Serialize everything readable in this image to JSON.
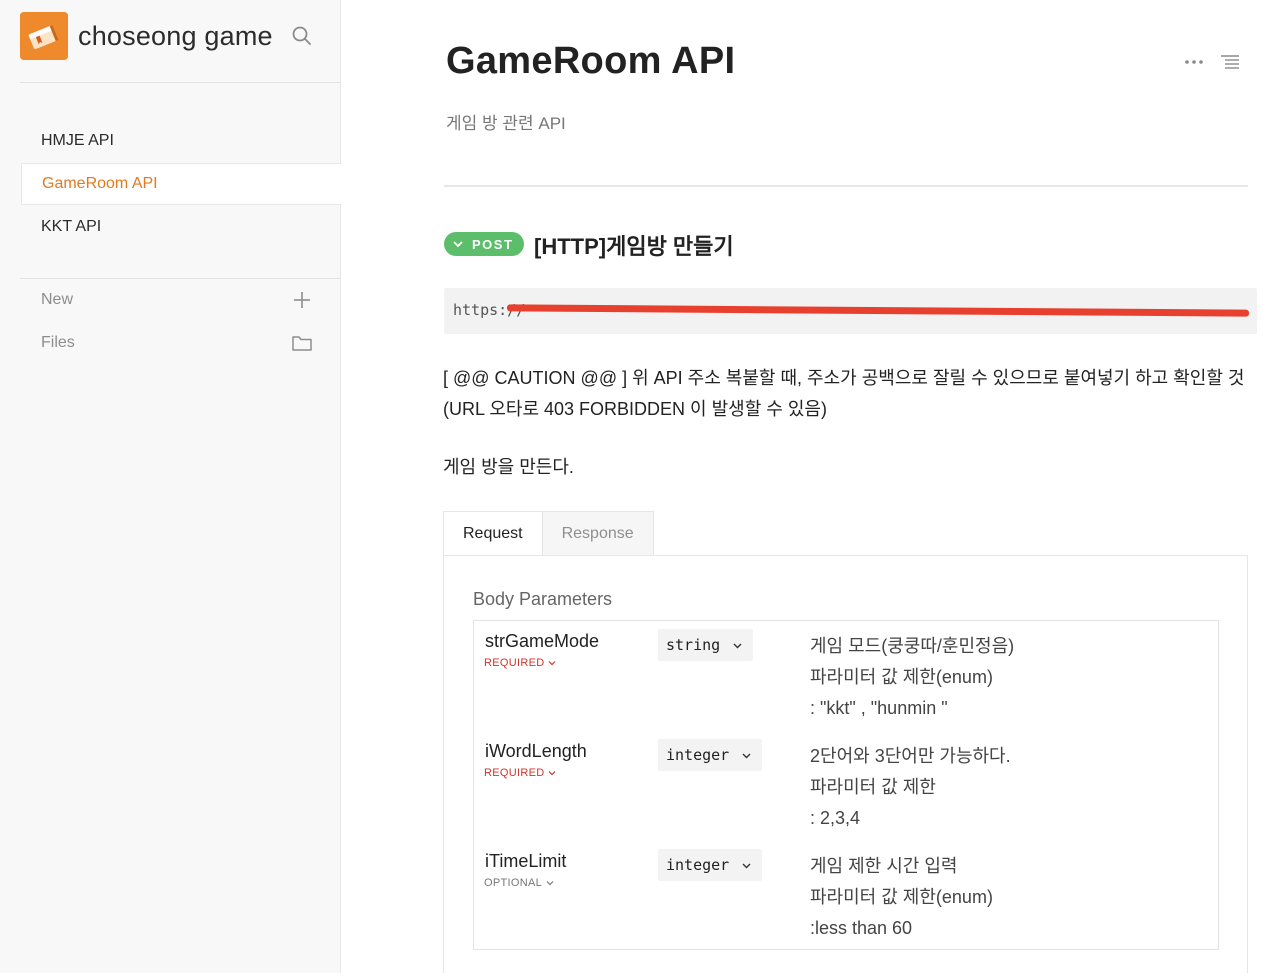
{
  "sidebar": {
    "brand_title": "choseong game",
    "nav_items": [
      {
        "label": "HMJE API",
        "active": false
      },
      {
        "label": "GameRoom API",
        "active": true
      },
      {
        "label": "KKT API",
        "active": false
      }
    ],
    "tools": [
      {
        "label": "New",
        "icon": "plus-icon"
      },
      {
        "label": "Files",
        "icon": "folder-icon"
      }
    ]
  },
  "header": {
    "title": "GameRoom API",
    "subtitle": "게임 방 관련 API"
  },
  "endpoint": {
    "method": "POST",
    "title": "[HTTP]게임방 만들기",
    "url_visible": "https://",
    "caution_line1": "[ @@ CAUTION @@ ] 위 API 주소 복붙할 때, 주소가 공백으로 잘릴 수 있으므로 붙여넣기 하고 확인할 것",
    "caution_line2": "(URL 오타로 403 FORBIDDEN 이 발생할 수 있음)",
    "description": "게임 방을 만든다."
  },
  "tabs": [
    {
      "label": "Request",
      "active": true
    },
    {
      "label": "Response",
      "active": false
    }
  ],
  "request": {
    "section_label": "Body Parameters",
    "params": [
      {
        "name": "strGameMode",
        "requirement": "REQUIRED",
        "type": "string",
        "desc": [
          "게임 모드(쿵쿵따/훈민정음)",
          "파라미터 값 제한(enum)",
          ": \"kkt\" , \"hunmin \""
        ]
      },
      {
        "name": "iWordLength",
        "requirement": "REQUIRED",
        "type": "integer",
        "desc": [
          "2단어와 3단어만 가능하다.",
          "파라미터 값 제한",
          ": 2,3,4"
        ]
      },
      {
        "name": "iTimeLimit",
        "requirement": "OPTIONAL",
        "type": "integer",
        "desc": [
          "게임 제한 시간 입력",
          "파라미터 값 제한(enum)",
          ":less than 60"
        ]
      }
    ]
  },
  "colors": {
    "accent": "#e07a20",
    "logo_bg": "#ef8a2c",
    "post_badge": "#5cbd6a",
    "required": "#d0342c",
    "redaction": "#e8402e"
  }
}
